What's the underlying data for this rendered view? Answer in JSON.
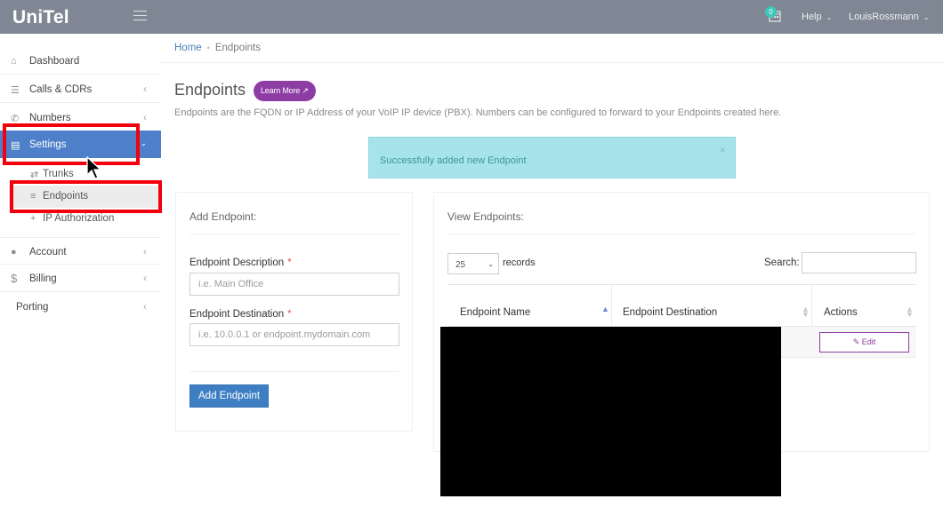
{
  "header": {
    "brand": "UniTel",
    "notification_count": "0",
    "help_label": "Help",
    "user_name": "LouisRossmann"
  },
  "sidebar": {
    "items": [
      {
        "label": "Dashboard",
        "icon": "home-icon"
      },
      {
        "label": "Calls & CDRs",
        "icon": "list-icon"
      },
      {
        "label": "Numbers",
        "icon": "phone-icon"
      },
      {
        "label": "Settings",
        "icon": "server-icon"
      },
      {
        "label": "Account",
        "icon": "user-icon"
      },
      {
        "label": "Billing",
        "icon": "dollar-icon"
      },
      {
        "label": "Porting",
        "icon": ""
      }
    ],
    "settings_children": [
      {
        "label": "Trunks",
        "icon": "exchange-icon"
      },
      {
        "label": "Endpoints",
        "icon": "server-icon"
      },
      {
        "label": "IP Authorization",
        "icon": "plus-icon"
      }
    ],
    "active_color": "#4d80c9",
    "highlight_color": "#f2000d"
  },
  "breadcrumb": {
    "home": "Home",
    "current": "Endpoints"
  },
  "page": {
    "title": "Endpoints",
    "learn_more": "Learn More",
    "description": "Endpoints are the FQDN or IP Address of your VoIP IP device (PBX). Numbers can be configured to forward to your Endpoints created here.",
    "alert": "Successfully added new Endpoint",
    "alert_close": "×"
  },
  "add_endpoint": {
    "title": "Add Endpoint:",
    "description_label": "Endpoint Description",
    "description_placeholder": "i.e. Main Office",
    "destination_label": "Endpoint Destination",
    "destination_placeholder": "i.e. 10.0.0.1 or endpoint.mydomain.com",
    "required_mark": "*",
    "submit": "Add Endpoint"
  },
  "view_endpoints": {
    "title": "View Endpoints:",
    "page_size": "25",
    "records_label": "records",
    "search_label": "Search:",
    "columns": [
      "Endpoint Name",
      "Endpoint Destination",
      "Actions"
    ],
    "edit_label": "Edit"
  }
}
